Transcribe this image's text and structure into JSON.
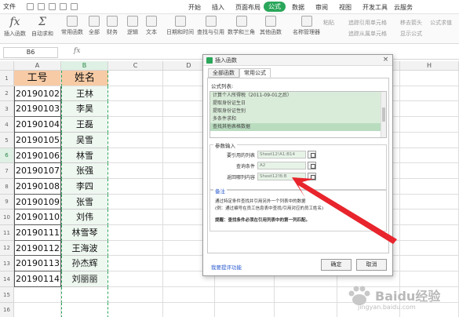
{
  "menubar": {
    "file_label": "文件",
    "tabs": [
      "开始",
      "插入",
      "页面布局",
      "公式",
      "数据",
      "审阅",
      "视图",
      "开发工具",
      "云服务"
    ],
    "active_tab": "公式"
  },
  "toolbar": {
    "tools": [
      "插入函数",
      "自动求和",
      "常用函数",
      "全部",
      "财务",
      "逻辑",
      "文本",
      "日期和时间",
      "查找与引用",
      "数学和三角",
      "其他函数",
      "名称管理器"
    ],
    "right_tools": [
      "粘贴",
      "追踪引用单元格",
      "移去箭头",
      "追踪从属单元格",
      "显示公式",
      "移去箭头",
      "公式求值"
    ]
  },
  "formula_bar": {
    "cell_ref": "B6",
    "fx": "fx"
  },
  "grid": {
    "columns": [
      "A",
      "B",
      "C",
      "D",
      "E",
      "F",
      "G",
      "H"
    ],
    "selected_column": "B",
    "selected_row": "6",
    "row_numbers": [
      "1",
      "2",
      "3",
      "4",
      "5",
      "6",
      "7",
      "8",
      "9",
      "10",
      "11",
      "12",
      "13",
      "14",
      "15",
      "16"
    ],
    "header_row": {
      "a": "工号",
      "b": "姓名"
    },
    "rows": [
      {
        "a": "20190102",
        "b": "王林"
      },
      {
        "a": "20190103",
        "b": "李昊"
      },
      {
        "a": "20190104",
        "b": "王磊"
      },
      {
        "a": "20190105",
        "b": "吴雪"
      },
      {
        "a": "20190106",
        "b": "林雪"
      },
      {
        "a": "20190107",
        "b": "张强"
      },
      {
        "a": "20190108",
        "b": "李四"
      },
      {
        "a": "20190109",
        "b": "张雪"
      },
      {
        "a": "20190110",
        "b": "刘伟"
      },
      {
        "a": "20190111",
        "b": "林雪琴"
      },
      {
        "a": "20190112",
        "b": "王海波"
      },
      {
        "a": "20190113",
        "b": "孙杰辉"
      },
      {
        "a": "20190114",
        "b": "刘丽丽"
      }
    ]
  },
  "dialog": {
    "title": "插入函数",
    "close": "×",
    "tabs": [
      "全部函数",
      "常用公式"
    ],
    "active_tab": "常用公式",
    "list_label": "公式列表:",
    "formulas": [
      "计算个人所得税（2011-09-01之后）",
      "提取身份证生日",
      "提取身份证性别",
      "多条件求和",
      "查找其他表格数据"
    ],
    "selected_formula": "查找其他表格数据",
    "params_label": "参数输入",
    "params": [
      {
        "label": "要引用的列表",
        "value": "Sheet12!A1:B14"
      },
      {
        "label": "查询条件",
        "value": "A2"
      },
      {
        "label": "返回哪列内容",
        "value": "Sheet12!B:B"
      }
    ],
    "notes_label": "备注",
    "notes": [
      "通过特定条件查找并引用另外一个列表中的数据",
      "(例：通过编号在员工信息表中查找/引用对应的员工姓名)",
      "提醒：查找条件必须在引用列表中的第一列匹配。"
    ],
    "link": "我要提评功能",
    "ok": "确定",
    "cancel": "取消"
  },
  "watermark": {
    "brand": "Baidu经验",
    "url": "jingyan.baidu.com"
  },
  "colors": {
    "accent": "#2aa65a",
    "header_fill": "#f7cba5",
    "arrow": "#e8242c",
    "link": "#2b5bd0"
  }
}
